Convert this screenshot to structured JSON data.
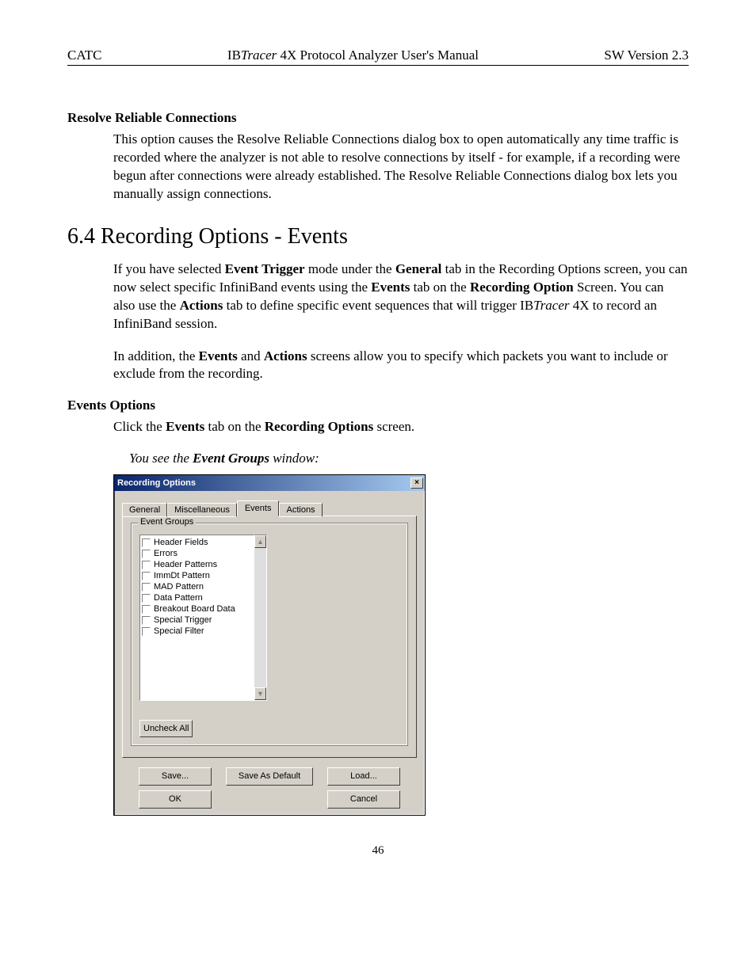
{
  "header": {
    "left": "CATC",
    "center_prefix": "IB",
    "center_ital": "Tracer",
    "center_suffix": " 4X Protocol Analyzer User's Manual",
    "right": "SW Version 2.3"
  },
  "sections": {
    "rrc_title": "Resolve Reliable Connections",
    "rrc_body": "This option causes the Resolve Reliable Connections dialog box to open automatically any time traffic is recorded where the analyzer is not able to resolve connections by itself - for example, if a recording were begun after connections were already established.  The Resolve Reliable Connections dialog box lets you manually assign connections.",
    "heading_64": "6.4  Recording Options - Events",
    "p64_a_pre": "If you have selected ",
    "p64_a_b1": "Event Trigger",
    "p64_a_mid1": " mode under the ",
    "p64_a_b2": "General",
    "p64_a_mid2": " tab in the Recording Options screen, you can now select specific InfiniBand events using the ",
    "p64_a_b3": "Events",
    "p64_a_mid3": " tab on the ",
    "p64_a_b4": "Recording Option",
    "p64_a_mid4": " Screen. You can also use the ",
    "p64_a_b5": "Actions",
    "p64_a_mid5": " tab to define specific event sequences that will trigger IB",
    "p64_a_i1": "Tracer",
    "p64_a_end": " 4X to record an InfiniBand session.",
    "p64_b_pre": "In addition, the ",
    "p64_b_b1": "Events",
    "p64_b_mid1": " and ",
    "p64_b_b2": "Actions",
    "p64_b_end": " screens allow you to specify which packets you want to include or exclude from the recording.",
    "ev_opts_title": "Events Options",
    "ev_opts_body_pre": "Click the ",
    "ev_opts_body_b1": "Events",
    "ev_opts_body_mid": " tab on the ",
    "ev_opts_body_b2": "Recording Options",
    "ev_opts_body_end": " screen.",
    "caption_pre": "You see the ",
    "caption_b": "Event Groups",
    "caption_end": " window:"
  },
  "dialog": {
    "title": "Recording Options",
    "close": "×",
    "tabs": [
      "General",
      "Miscellaneous",
      "Events",
      "Actions"
    ],
    "active_tab_index": 2,
    "group_legend": "Event Groups",
    "items": [
      "Header Fields",
      "Errors",
      "Header Patterns",
      "ImmDt Pattern",
      "MAD Pattern",
      "Data Pattern",
      "Breakout Board Data",
      "Special Trigger",
      "Special Filter"
    ],
    "uncheck_all": "Uncheck All",
    "buttons": {
      "save": "Save...",
      "ok": "OK",
      "save_default": "Save As Default",
      "load": "Load...",
      "cancel": "Cancel"
    }
  },
  "page_number": "46"
}
